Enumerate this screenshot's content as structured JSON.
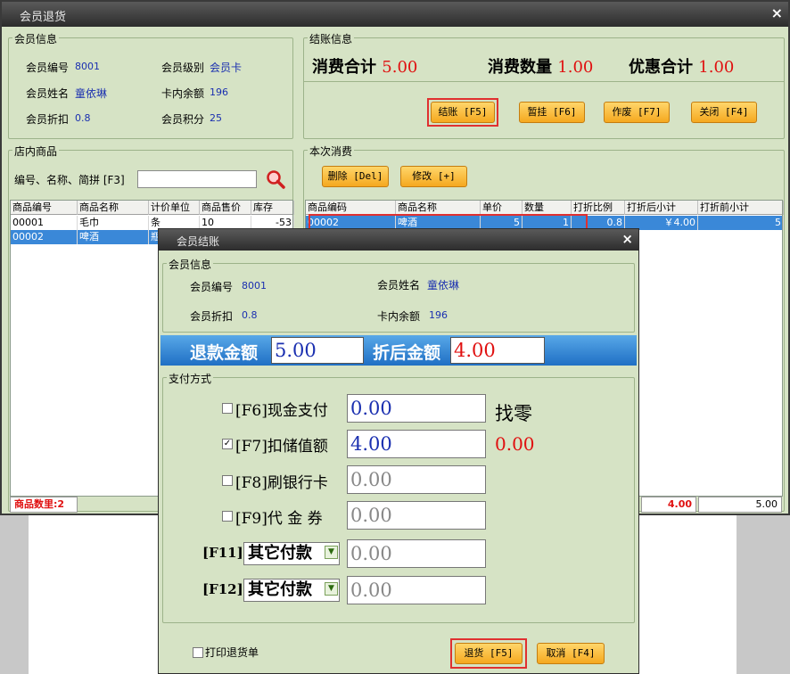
{
  "main": {
    "title": "会员退货",
    "close": "×",
    "member_info": {
      "group": "会员信息",
      "id_label": "会员编号",
      "id_value": "8001",
      "level_label": "会员级别",
      "level_value": "会员卡",
      "name_label": "会员姓名",
      "name_value": "童依琳",
      "balance_label": "卡内余额",
      "balance_value": "196",
      "discount_label": "会员折扣",
      "discount_value": "0.8",
      "points_label": "会员积分",
      "points_value": "25"
    },
    "checkout": {
      "group": "结账信息",
      "total_label": "消费合计",
      "total_value": "5.00",
      "qty_label": "消费数量",
      "qty_value": "1.00",
      "discount_label": "优惠合计",
      "discount_value": "1.00",
      "btn_checkout": "结账 [F5]",
      "btn_hold": "暂挂 [F6]",
      "btn_void": "作废 [F7]",
      "btn_close": "关闭 [F4]"
    },
    "store_goods": {
      "group": "店内商品",
      "search_label": "编号、名称、简拼 [F3]",
      "search_value": "",
      "headers": [
        "商品编号",
        "商品名称",
        "计价单位",
        "商品售价",
        "库存"
      ],
      "rows": [
        [
          "00001",
          "毛巾",
          "条",
          "10",
          "-53"
        ],
        [
          "00002",
          "啤酒",
          "瓶",
          "",
          ""
        ]
      ],
      "footer": "商品数里:2"
    },
    "current": {
      "group": "本次消费",
      "btn_delete": "删除 [Del]",
      "btn_edit": "修改 [+]",
      "headers": [
        "商品编码",
        "商品名称",
        "单价",
        "数量",
        "打折比例",
        "打折后小计",
        "打折前小计"
      ],
      "rows": [
        [
          "00002",
          "啤酒",
          "5",
          "1",
          "0.8",
          "￥4.00",
          "5"
        ]
      ],
      "footer_after": "4.00",
      "footer_before": "5.00"
    }
  },
  "dialog": {
    "title": "会员结账",
    "close": "×",
    "member": {
      "group": "会员信息",
      "id_label": "会员编号",
      "id_value": "8001",
      "name_label": "会员姓名",
      "name_value": "童依琳",
      "discount_label": "会员折扣",
      "discount_value": "0.8",
      "balance_label": "卡内余额",
      "balance_value": "196"
    },
    "refund_label": "退款金额",
    "refund_value": "5.00",
    "after_label": "折后金额",
    "after_value": "4.00",
    "payment": {
      "group": "支付方式",
      "cash_label": "[F6]现金支付",
      "cash_value": "0.00",
      "cash_checked": "",
      "change_label": "找零",
      "stored_label": "[F7]扣储值额",
      "stored_value": "4.00",
      "stored_checked": "✓",
      "change_value": "0.00",
      "bank_label": "[F8]刷银行卡",
      "bank_value": "0.00",
      "bank_checked": "",
      "voucher_label": "[F9]代 金 券",
      "voucher_value": "0.00",
      "voucher_checked": "",
      "f11_label": "[F11]",
      "f11_select": "其它付款",
      "f11_value": "0.00",
      "f12_label": "[F12]",
      "f12_select": "其它付款",
      "f12_value": "0.00",
      "dd_arrow": "▼"
    },
    "print_label": "打印退货单",
    "btn_return": "退货 [F5]",
    "btn_cancel": "取消 [F4]"
  },
  "colors": {
    "panel": "#d6e3c5",
    "accent_red": "#e01010",
    "accent_blue": "#1a2fb0",
    "button_orange": "#f5a81f",
    "select_blue": "#3a88d8"
  }
}
